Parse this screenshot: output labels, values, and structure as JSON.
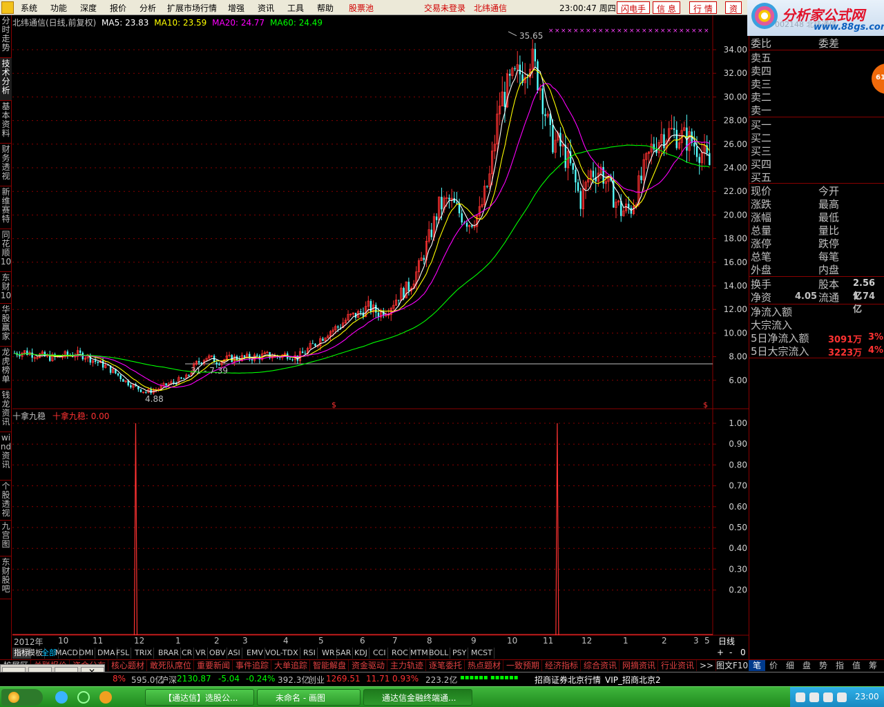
{
  "menu": {
    "items": [
      "系统",
      "功能",
      "深度",
      "报价",
      "分析",
      "扩展市场行情",
      "增强",
      "资讯",
      "工具",
      "帮助"
    ],
    "stock_pool": "股票池",
    "login_status": "交易未登录",
    "stock_name": "北纬通信",
    "clock": "23:00:47 周四",
    "buttons": [
      "闪电手",
      "信 息",
      "行 情",
      "资"
    ]
  },
  "brand": {
    "title": "分析家公式网",
    "url": "www.88gs.com",
    "ghost": "002148 北纬通信"
  },
  "left_tabs": [
    "分时走势",
    "技术分析",
    "基本资料",
    "财务透视",
    "新维赛特",
    "同花顺10",
    "东财10",
    "华股赢家",
    "龙虎榜单",
    "钱龙资讯",
    "wind资讯",
    "个股透视",
    "九宫图",
    "东财股吧"
  ],
  "main_chart": {
    "title": "北纬通信(日线,前复权)",
    "ma5_label": "MA5: 23.83",
    "ma10_label": "MA10: 23.59",
    "ma20_label": "MA20: 24.77",
    "ma60_label": "MA60: 24.49",
    "colors": {
      "ma5": "#ffffff",
      "ma10": "#ffff00",
      "ma20": "#ff00ff",
      "ma60": "#00ff00",
      "up": "#ff3232",
      "down": "#54ffff",
      "grid": "#8a0000"
    },
    "high_annotation": "35.65",
    "low_annotation": "4.88",
    "line_annotation": "31 - 7.39"
  },
  "chart_data": [
    {
      "type": "candlestick",
      "title": "北纬通信(日线,前复权)",
      "y_ticks": [
        "34.00",
        "32.00",
        "30.00",
        "28.00",
        "26.00",
        "24.00",
        "22.00",
        "20.00",
        "18.00",
        "16.00",
        "14.00",
        "12.00",
        "10.00",
        "8.00",
        "6.00"
      ],
      "y_tick_values": [
        34,
        32,
        30,
        28,
        26,
        24,
        22,
        20,
        18,
        16,
        14,
        12,
        10,
        8,
        6
      ],
      "x_labels": [
        "2012年",
        "10",
        "11",
        "12",
        "1",
        "2",
        "3",
        "4",
        "5",
        "6",
        "7",
        "8",
        "9",
        "10",
        "11",
        "12",
        "1",
        "2",
        "3",
        "5"
      ],
      "horizontal_reference": 7.39,
      "close_series": [
        8.3,
        8.4,
        8.2,
        8.0,
        7.9,
        8.1,
        8.2,
        8.1,
        7.6,
        7.2,
        6.6,
        5.9,
        5.4,
        5.0,
        5.2,
        5.6,
        5.9,
        6.2,
        7.4,
        8.0,
        7.6,
        7.8,
        7.9,
        7.9,
        8.0,
        8.1,
        8.0,
        8.2,
        7.9,
        8.6,
        9.3,
        10.1,
        10.5,
        11.3,
        11.6,
        12.2,
        11.7,
        12.1,
        13.2,
        13.9,
        15.5,
        18.0,
        20.7,
        21.2,
        20.2,
        19.4,
        20.1,
        23.2,
        29.5,
        31.0,
        32.0,
        33.5,
        31.0,
        26.5,
        25.8,
        24.0,
        21.2,
        23.6,
        23.8,
        22.0,
        20.3,
        20.6,
        23.0,
        25.6,
        26.8,
        27.0,
        26.6,
        26.2,
        25.3,
        23.83
      ],
      "high": 35.65,
      "low": 4.88,
      "ma5_last": 23.83,
      "ma10_last": 23.59,
      "ma20_last": 24.77,
      "ma60_last": 24.49
    },
    {
      "type": "line",
      "title": "十拿九稳",
      "series_label": "十拿九稳: 0.00",
      "y_ticks": [
        "1.00",
        "0.90",
        "0.80",
        "0.70",
        "0.60",
        "0.50",
        "0.40",
        "0.30",
        "0.20"
      ],
      "y_tick_values": [
        1.0,
        0.9,
        0.8,
        0.7,
        0.6,
        0.5,
        0.4,
        0.3,
        0.2
      ],
      "spikes": [
        {
          "position": 0.176,
          "value": 1.0
        },
        {
          "position": 0.778,
          "value": 1.0
        }
      ],
      "baseline": 0.0
    }
  ],
  "indicator": {
    "name": "十拿九稳",
    "label": "十拿九稳: 0.00"
  },
  "right_panel": {
    "header": [
      "委比",
      "委差"
    ],
    "sell": [
      "卖五",
      "卖四",
      "卖三",
      "卖二",
      "卖一"
    ],
    "buy": [
      "买一",
      "买二",
      "买三",
      "买四",
      "买五"
    ],
    "stats_left": [
      "现价",
      "涨跌",
      "涨幅",
      "总量",
      "涨停",
      "总笔",
      "外盘"
    ],
    "stats_right": [
      "今开",
      "最高",
      "最低",
      "量比",
      "跌停",
      "每笔",
      "内盘"
    ],
    "turnover_label": "换手",
    "capital_label": "股本",
    "capital_value": "2.56亿",
    "net_asset_label": "净资",
    "net_asset_value": "4.05",
    "float_label": "流通",
    "float_value": "1.74亿",
    "flow": [
      "净流入额",
      "大宗流入"
    ],
    "flow5_net_label": "5日净流入额",
    "flow5_net_value": "3091万",
    "flow5_net_pct": "3%",
    "flow5_block_label": "5日大宗流入",
    "flow5_block_value": "3223万",
    "flow5_block_pct": "4%",
    "badge": "61"
  },
  "bottom": {
    "period": "日线",
    "indicator_tabs": [
      "指标",
      "模板",
      "全部",
      "MACD",
      "DMI",
      "DMA",
      "FSL",
      "TRIX",
      "BRAR",
      "CR",
      "VR",
      "OBV",
      "ASI",
      "EMV",
      "VOL-TDX",
      "RSI",
      "WR",
      "SAR",
      "KDJ",
      "CCI",
      "ROC",
      "MTM",
      "BOLL",
      "PSY",
      "MCST"
    ],
    "zoom": [
      "+",
      "-",
      "0"
    ],
    "func_tabs": [
      "扩展区",
      "关联报价",
      "资金分布",
      "核心题材",
      "敢死队席位",
      "重要新闻",
      "事件追踪",
      "大单追踪",
      "智能解盘",
      "资金驱动",
      "主力轨迹",
      "逐笔委托",
      "热点题材",
      "一致预期",
      "经济指标",
      "综合资讯",
      "网摘资讯",
      "行业资讯",
      ">>",
      "图文F10"
    ],
    "right_tabs": [
      "笔",
      "价",
      "细",
      "盘",
      "势",
      "指",
      "值",
      "筹"
    ]
  },
  "status": {
    "a": "8%",
    "b": "595.0亿",
    "sh_label": "沪深",
    "sh_value": "2130.87",
    "sh_change": "-5.04",
    "sh_pct": "-0.24%",
    "sh_amt": "392.3亿",
    "cy_label": "创业",
    "cy_value": "1269.51",
    "cy_change": "11.71",
    "cy_pct": "0.93%",
    "cy_amt": "223.2亿",
    "broker": "招商证券北京行情",
    "vip": "VIP_招商北京2"
  },
  "taskbar": {
    "items": [
      "【通达信】选股公...",
      "未命名 - 画图",
      "通达信金融终端通..."
    ],
    "time": "23:00"
  }
}
